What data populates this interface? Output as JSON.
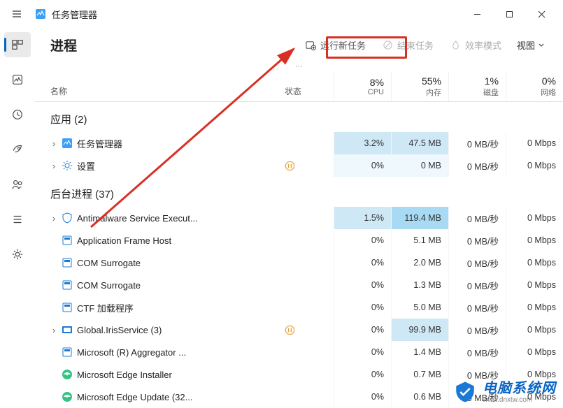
{
  "app": {
    "title": "任务管理器"
  },
  "window_controls": {
    "min": "min",
    "max": "max",
    "close": "close"
  },
  "sidebar": {
    "items": [
      {
        "name": "processes",
        "active": true
      },
      {
        "name": "performance"
      },
      {
        "name": "history"
      },
      {
        "name": "startup"
      },
      {
        "name": "users"
      },
      {
        "name": "details"
      },
      {
        "name": "services"
      }
    ]
  },
  "header": {
    "title": "进程",
    "new_task": "运行新任务",
    "end_task": "结束任务",
    "efficiency": "效率模式",
    "view": "视图"
  },
  "columns": {
    "name": "名称",
    "status": "状态",
    "cpu_pct": "8%",
    "cpu_lbl": "CPU",
    "mem_pct": "55%",
    "mem_lbl": "内存",
    "disk_pct": "1%",
    "disk_lbl": "磁盘",
    "net_pct": "0%",
    "net_lbl": "网络"
  },
  "groups": {
    "apps": {
      "label": "应用 (2)"
    },
    "bg": {
      "label": "后台进程 (37)"
    }
  },
  "rows": [
    {
      "g": "apps",
      "expand": true,
      "icon": "taskmgr",
      "name": "任务管理器",
      "status": "",
      "cpu": "3.2%",
      "mem": "47.5 MB",
      "disk": "0 MB/秒",
      "net": "0 Mbps",
      "hl_cpu": 1,
      "hl_mem": 1
    },
    {
      "g": "apps",
      "expand": true,
      "icon": "settings",
      "name": "设置",
      "status": "pause",
      "cpu": "0%",
      "mem": "0 MB",
      "disk": "0 MB/秒",
      "net": "0 Mbps",
      "hl_cpu": 3,
      "hl_mem": 3
    },
    {
      "g": "bg",
      "expand": true,
      "icon": "shield",
      "name": "Antimalware Service Execut...",
      "status": "",
      "cpu": "1.5%",
      "mem": "119.4 MB",
      "disk": "0 MB/秒",
      "net": "0 Mbps",
      "hl_cpu": 1,
      "hl_mem": 2
    },
    {
      "g": "bg",
      "expand": false,
      "icon": "app",
      "name": "Application Frame Host",
      "status": "",
      "cpu": "0%",
      "mem": "5.1 MB",
      "disk": "0 MB/秒",
      "net": "0 Mbps"
    },
    {
      "g": "bg",
      "expand": false,
      "icon": "app",
      "name": "COM Surrogate",
      "status": "",
      "cpu": "0%",
      "mem": "2.0 MB",
      "disk": "0 MB/秒",
      "net": "0 Mbps"
    },
    {
      "g": "bg",
      "expand": false,
      "icon": "app",
      "name": "COM Surrogate",
      "status": "",
      "cpu": "0%",
      "mem": "1.3 MB",
      "disk": "0 MB/秒",
      "net": "0 Mbps"
    },
    {
      "g": "bg",
      "expand": false,
      "icon": "app",
      "name": "CTF 加载程序",
      "status": "",
      "cpu": "0%",
      "mem": "5.0 MB",
      "disk": "0 MB/秒",
      "net": "0 Mbps"
    },
    {
      "g": "bg",
      "expand": true,
      "icon": "iris",
      "name": "Global.IrisService (3)",
      "status": "pause",
      "cpu": "0%",
      "mem": "99.9 MB",
      "disk": "0 MB/秒",
      "net": "0 Mbps",
      "hl_mem": 1
    },
    {
      "g": "bg",
      "expand": false,
      "icon": "app",
      "name": "Microsoft (R) Aggregator ...",
      "status": "",
      "cpu": "0%",
      "mem": "1.4 MB",
      "disk": "0 MB/秒",
      "net": "0 Mbps"
    },
    {
      "g": "bg",
      "expand": false,
      "icon": "edge",
      "name": "Microsoft Edge Installer",
      "status": "",
      "cpu": "0%",
      "mem": "0.7 MB",
      "disk": "0 MB/秒",
      "net": "0 Mbps"
    },
    {
      "g": "bg",
      "expand": false,
      "icon": "edge",
      "name": "Microsoft Edge Update (32...",
      "status": "",
      "cpu": "0%",
      "mem": "0.6 MB",
      "disk": "0 MB/秒",
      "net": "0 Mbps"
    }
  ],
  "watermark": {
    "main": "电脑系统网",
    "sub": "www.dnxtw.com"
  }
}
